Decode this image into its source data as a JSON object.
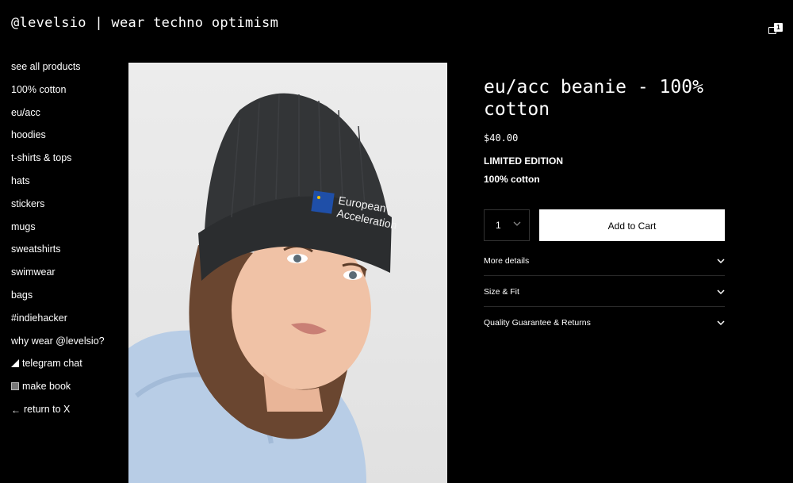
{
  "header": {
    "title": "@levelsio | wear techno optimism",
    "cart_count": "1"
  },
  "sidebar": {
    "items": [
      {
        "label": "see all products"
      },
      {
        "label": "100% cotton"
      },
      {
        "label": "eu/acc"
      },
      {
        "label": "hoodies"
      },
      {
        "label": "t-shirts & tops"
      },
      {
        "label": "hats"
      },
      {
        "label": "stickers"
      },
      {
        "label": "mugs"
      },
      {
        "label": "sweatshirts"
      },
      {
        "label": "swimwear"
      },
      {
        "label": "bags"
      },
      {
        "label": "#indiehacker"
      },
      {
        "label": "why wear @levelsio?"
      },
      {
        "label": "telegram chat",
        "icon": "triangle-icon"
      },
      {
        "label": "make book",
        "icon": "square-icon"
      },
      {
        "label": "return to X",
        "icon": "←"
      }
    ]
  },
  "product": {
    "title": "eu/acc beanie - 100% cotton",
    "price": "$40.00",
    "edition": "LIMITED EDITION",
    "material": "100% cotton",
    "quantity": "1",
    "add_to_cart_label": "Add to Cart",
    "image_logo_text": [
      "European",
      "Acceleration"
    ],
    "accordion": [
      {
        "label": "More details"
      },
      {
        "label": "Size & Fit"
      },
      {
        "label": "Quality Guarantee & Returns"
      }
    ]
  }
}
